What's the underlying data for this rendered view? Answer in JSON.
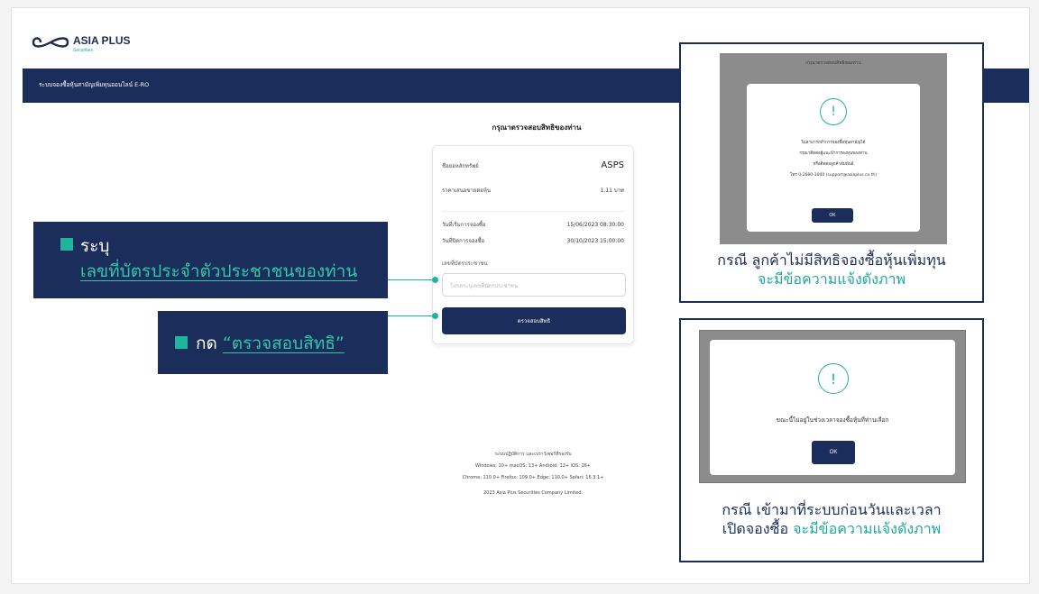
{
  "brand": {
    "name": "ASIA PLUS",
    "sub": "Securities"
  },
  "navbar": {
    "title": "ระบบจองซื้อหุ้นสามัญเพิ่มทุนออนไลน์ E-RO"
  },
  "form": {
    "title": "กรุณาตรวจสอบสิทธิของท่าน",
    "rows": [
      {
        "label": "ชื่อย่อหลักทรัพย์",
        "value": "ASPS"
      },
      {
        "label": "ราคาเสนอขายต่อหุ้น",
        "value": "1.11 บาท"
      },
      {
        "label": "วันที่เริ่มการจองซื้อ",
        "value": "15/06/2023 08:30:00"
      },
      {
        "label": "วันที่ปิดการจองซื้อ",
        "value": "30/10/2023 15:00:00"
      }
    ],
    "id_label": "เลขที่บัตรประชาชน",
    "id_placeholder": "โปรดระบุเลขที่บัตรประชาชน",
    "check_button": "ตรวจสอบสิทธิ"
  },
  "footer": {
    "line1": "ระบบปฏิบัติการ และเบราว์เซอร์ที่รองรับ",
    "line2": "Windows: 10+   macOS: 13+   Android: 12+   iOS: 16+",
    "line3": "Chrome: 110.0+   Firefox: 109.0+   Edge: 110.0+   Safari: 16.3.1+",
    "line4": "2023 Asia Plus Securities Company Limited."
  },
  "callouts": {
    "specify_label": "ระบุ",
    "specify_target": "เลขที่บัตรประจำตัวประชาชนของท่าน",
    "press_label": "กด",
    "press_target": "“ตรวจสอบสิทธิ”"
  },
  "panel_a": {
    "screen_title": "กรุณาตรวจสอบสิทธิของท่าน",
    "icon_glyph": "!",
    "message_line1": "ไม่สามารถทำการจองซื้อหุ้นสามัญได้",
    "message_line2": "กรุณาติดต่อผู้แนะนำการลงทุนของท่าน",
    "message_line3": "หรือติดต่อลูกค้าสัมพันธ์",
    "message_line4": "โทร 0-2680-1000 (support@asiaplus.co.th)",
    "ok": "OK",
    "caption_line1": "กรณี ลูกค้าไม่มีสิทธิจองซื้อหุ้นเพิ่มทุน",
    "caption_line2": "จะมีข้อความแจ้งดังภาพ"
  },
  "panel_b": {
    "icon_glyph": "!",
    "message": "ขณะนี้ไม่อยู่ในช่วงเวลาจองซื้อหุ้นที่ท่านเลือก",
    "ok": "OK",
    "caption_line1": "กรณี เข้ามาที่ระบบก่อนวันและเวลา",
    "caption_line2a": "เปิดจองซื้อ",
    "caption_line2b": "จะมีข้อความแจ้งดังภาพ"
  },
  "colors": {
    "navy": "#1b2d5a",
    "teal": "#1fb59c"
  }
}
